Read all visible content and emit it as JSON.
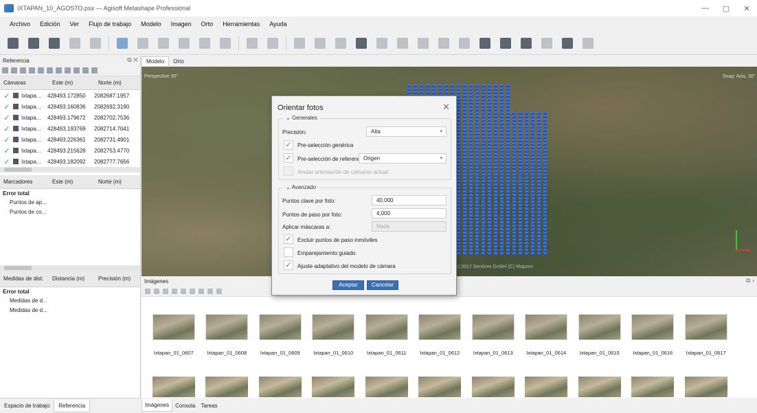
{
  "window": {
    "title": "IXTAPAN_10_AGOSTO.psx — Agisoft Metashape Professional",
    "controls": [
      "—",
      "▢",
      "✕"
    ]
  },
  "menu": [
    "Archivo",
    "Edición",
    "Ver",
    "Flujo de trabajo",
    "Modelo",
    "Imagen",
    "Orto",
    "Herramientas",
    "Ayuda"
  ],
  "reference_panel": {
    "title": "Referencia",
    "cameras_header": [
      "Cámaras",
      "Este (m)",
      "Norte (m)"
    ],
    "cameras": [
      {
        "name": "Ixtapa...",
        "este": "428493.172850",
        "norte": "2082687.1957"
      },
      {
        "name": "Ixtapa...",
        "este": "428493.160836",
        "norte": "2082692.3190"
      },
      {
        "name": "Ixtapa...",
        "este": "428493.179672",
        "norte": "2082702.7536"
      },
      {
        "name": "Ixtapa...",
        "este": "428493.193769",
        "norte": "2082714.7041"
      },
      {
        "name": "Ixtapa...",
        "este": "428493.226361",
        "norte": "2082731.4901"
      },
      {
        "name": "Ixtapa...",
        "este": "428493.215628",
        "norte": "2082753.4770"
      },
      {
        "name": "Ixtapa...",
        "este": "428493.182092",
        "norte": "2082777.7656"
      }
    ],
    "markers_header": [
      "Marcadores",
      "Este (m)",
      "Norte (m)"
    ],
    "markers_total": "Error total",
    "markers_items": [
      "Puntos de ap...",
      "Puntos de co..."
    ],
    "measures_header": [
      "Medidas de dist:",
      "Distancia (m)",
      "Precisión (m)"
    ],
    "measures_total": "Error total",
    "measures_items": [
      "Medidas de d...",
      "Medidas de d..."
    ],
    "tabs": [
      "Espacio de trabajo",
      "Referencia"
    ]
  },
  "view": {
    "tabs": [
      "Modelo",
      "Orto"
    ],
    "perspective_label": "Perspective 30°",
    "snap_label": "Snap: Axis, 30°",
    "credit": "(c) 2017 Services GmbH (C) Mapzen"
  },
  "images_panel": {
    "title": "Imágenes",
    "thumbnails": [
      "Ixtapan_01_0607",
      "Ixtapan_01_0608",
      "Ixtapan_01_0609",
      "Ixtapan_01_0610",
      "Ixtapan_01_0611",
      "Ixtapan_01_0612",
      "Ixtapan_01_0613",
      "Ixtapan_01_0614",
      "Ixtapan_01_0615",
      "Ixtapan_01_0616",
      "Ixtapan_01_0617"
    ],
    "tabs": [
      "Imágenes",
      "Consola",
      "Tareas"
    ]
  },
  "dialog": {
    "title": "Orientar fotos",
    "general_group": "Generales",
    "precision_label": "Precisión:",
    "precision_value": "Alta",
    "generic_preselection": "Pre-selección genérica",
    "reference_preselection": "Pre-selección de referencia",
    "reference_preselection_value": "Origen",
    "reset_alignment": "Anular orientación de cámaras actual",
    "advanced_group": "Avanzado",
    "key_points_label": "Puntos clave por foto:",
    "key_points_value": "40,000",
    "tie_points_label": "Puntos de paso por foto:",
    "tie_points_value": "4,000",
    "masks_label": "Aplicar máscaras a:",
    "masks_value": "Nada",
    "exclude_stationary": "Excluir puntos de paso inmóviles",
    "guided_matching": "Emparejamiento guiado",
    "adaptive_fitting": "Ajuste adaptativo del modelo de cámara",
    "ok_button": "Aceptar",
    "cancel_button": "Cancelar"
  }
}
